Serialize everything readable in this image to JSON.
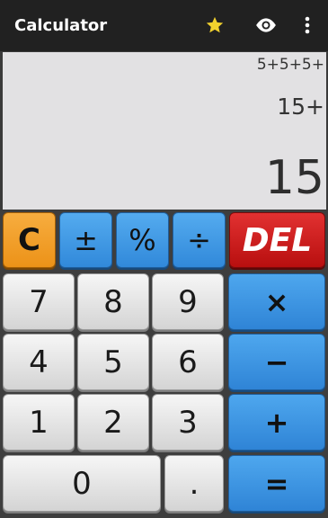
{
  "app": {
    "title": "Calculator",
    "icons": {
      "favorite": "star-icon",
      "view": "eye-icon",
      "menu": "more-vert-icon"
    },
    "colors": {
      "topbar": "#212121",
      "star": "#f2d22e",
      "display": "#e2e1e3",
      "blue": "#3a8fe0",
      "orange": "#f2a12a",
      "red": "#cc1f1f"
    }
  },
  "display": {
    "history": "5+5+5+",
    "expression": "15+",
    "result": "15"
  },
  "keys": {
    "clear": "C",
    "plus_minus": "±",
    "percent": "%",
    "divide": "÷",
    "delete": "DEL",
    "seven": "7",
    "eight": "8",
    "nine": "9",
    "multiply": "×",
    "four": "4",
    "five": "5",
    "six": "6",
    "minus": "−",
    "one": "1",
    "two": "2",
    "three": "3",
    "plus": "+",
    "zero": "0",
    "decimal": ".",
    "equals": "="
  }
}
